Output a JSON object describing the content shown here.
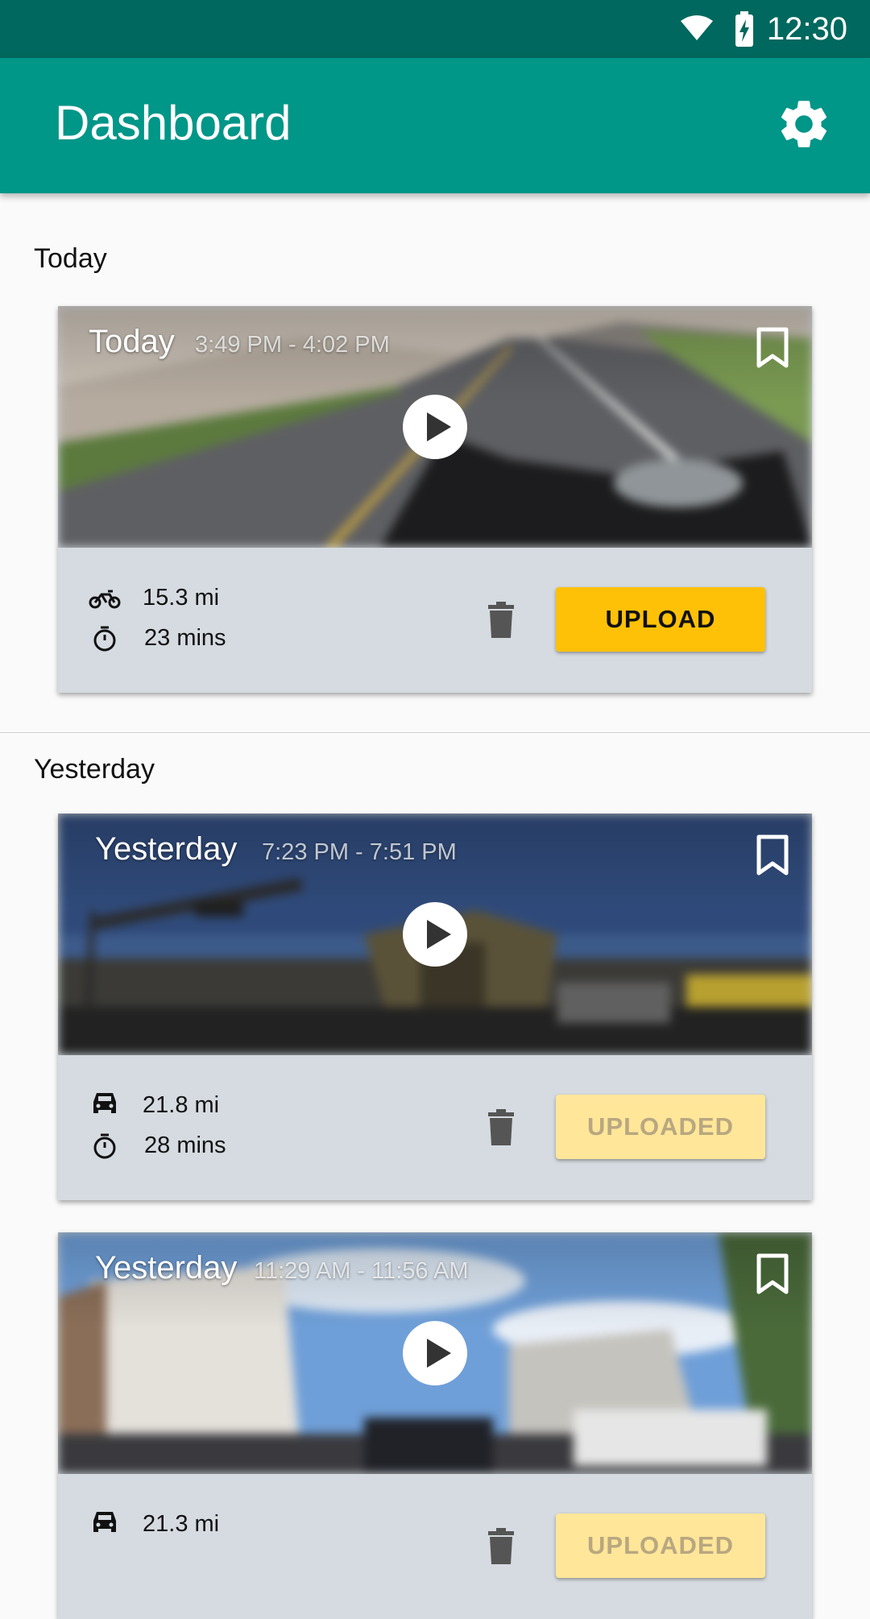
{
  "status_bar": {
    "time": "12:30",
    "wifi_icon": "wifi-icon",
    "battery_icon": "battery-charging-icon"
  },
  "app_bar": {
    "title": "Dashboard",
    "settings_icon": "gear-icon"
  },
  "sections": {
    "today": {
      "label": "Today"
    },
    "yesterday": {
      "label": "Yesterday"
    }
  },
  "cards": [
    {
      "day": "Today",
      "time_range": "3:49 PM - 4:02 PM",
      "vehicle_icon": "motorcycle-icon",
      "distance": "15.3 mi",
      "duration": "23 mins",
      "button_label": "UPLOAD",
      "button_state": "active"
    },
    {
      "day": "Yesterday",
      "time_range": "7:23 PM - 7:51 PM",
      "vehicle_icon": "car-icon",
      "distance": "21.8 mi",
      "duration": "28 mins",
      "button_label": "UPLOADED",
      "button_state": "done"
    },
    {
      "day": "Yesterday",
      "time_range": "11:29 AM - 11:56 AM",
      "vehicle_icon": "car-icon",
      "distance": "21.3 mi",
      "duration": "",
      "button_label": "UPLOADED",
      "button_state": "done"
    }
  ],
  "colors": {
    "status_bar": "#00685e",
    "app_bar": "#009688",
    "upload_button": "#ffc107",
    "uploaded_button": "#ffe699",
    "card_background": "#d5dbe0"
  }
}
